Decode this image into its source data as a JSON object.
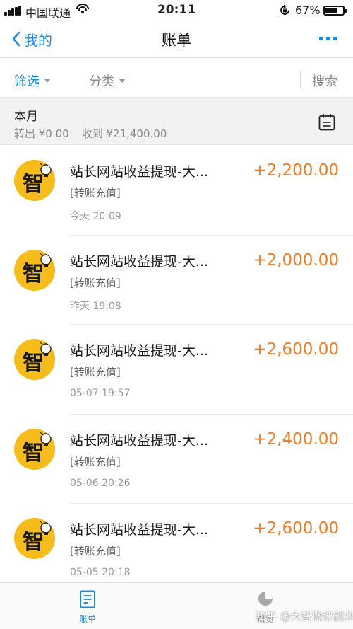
{
  "status_bar": {
    "carrier": "中国联通",
    "time": "20:11",
    "battery_percent": "67%",
    "battery_level": 0.67,
    "icons": [
      "signal-icon",
      "wifi-hotspot-icon",
      "orientation-lock-icon",
      "battery-icon"
    ]
  },
  "nav": {
    "back_label": "我的",
    "title": "账单",
    "more_icon": "more-icon"
  },
  "filters": {
    "filter_label": "筛选",
    "category_label": "分类",
    "search_label": "搜索"
  },
  "month": {
    "title": "本月",
    "out_label": "转出 ¥0.00",
    "in_label": "收到 ¥21,400.00",
    "calendar_icon": "calendar-icon"
  },
  "records": [
    {
      "title": "站长网站收益提现-大...",
      "tag": "[转账充值]",
      "time": "今天  20:09",
      "amount": "+2,200.00"
    },
    {
      "title": "站长网站收益提现-大...",
      "tag": "[转账充值]",
      "time": "昨天  19:08",
      "amount": "+2,000.00"
    },
    {
      "title": "站长网站收益提现-大...",
      "tag": "[转账充值]",
      "time": "05-07  19:57",
      "amount": "+2,600.00"
    },
    {
      "title": "站长网站收益提现-大...",
      "tag": "[转账充值]",
      "time": "05-06  20:26",
      "amount": "+2,400.00"
    },
    {
      "title": "站长网站收益提现-大...",
      "tag": "[转账充值]",
      "time": "05-05  20:18",
      "amount": "+2,600.00"
    }
  ],
  "tabs": {
    "bill_label": "账单",
    "overview_label": "概览"
  },
  "watermark": "知乎 @大智微课创业",
  "colors": {
    "accent": "#1a8cd8",
    "amount": "#ee7d24",
    "avatar_bg": "#f6bc1c"
  }
}
